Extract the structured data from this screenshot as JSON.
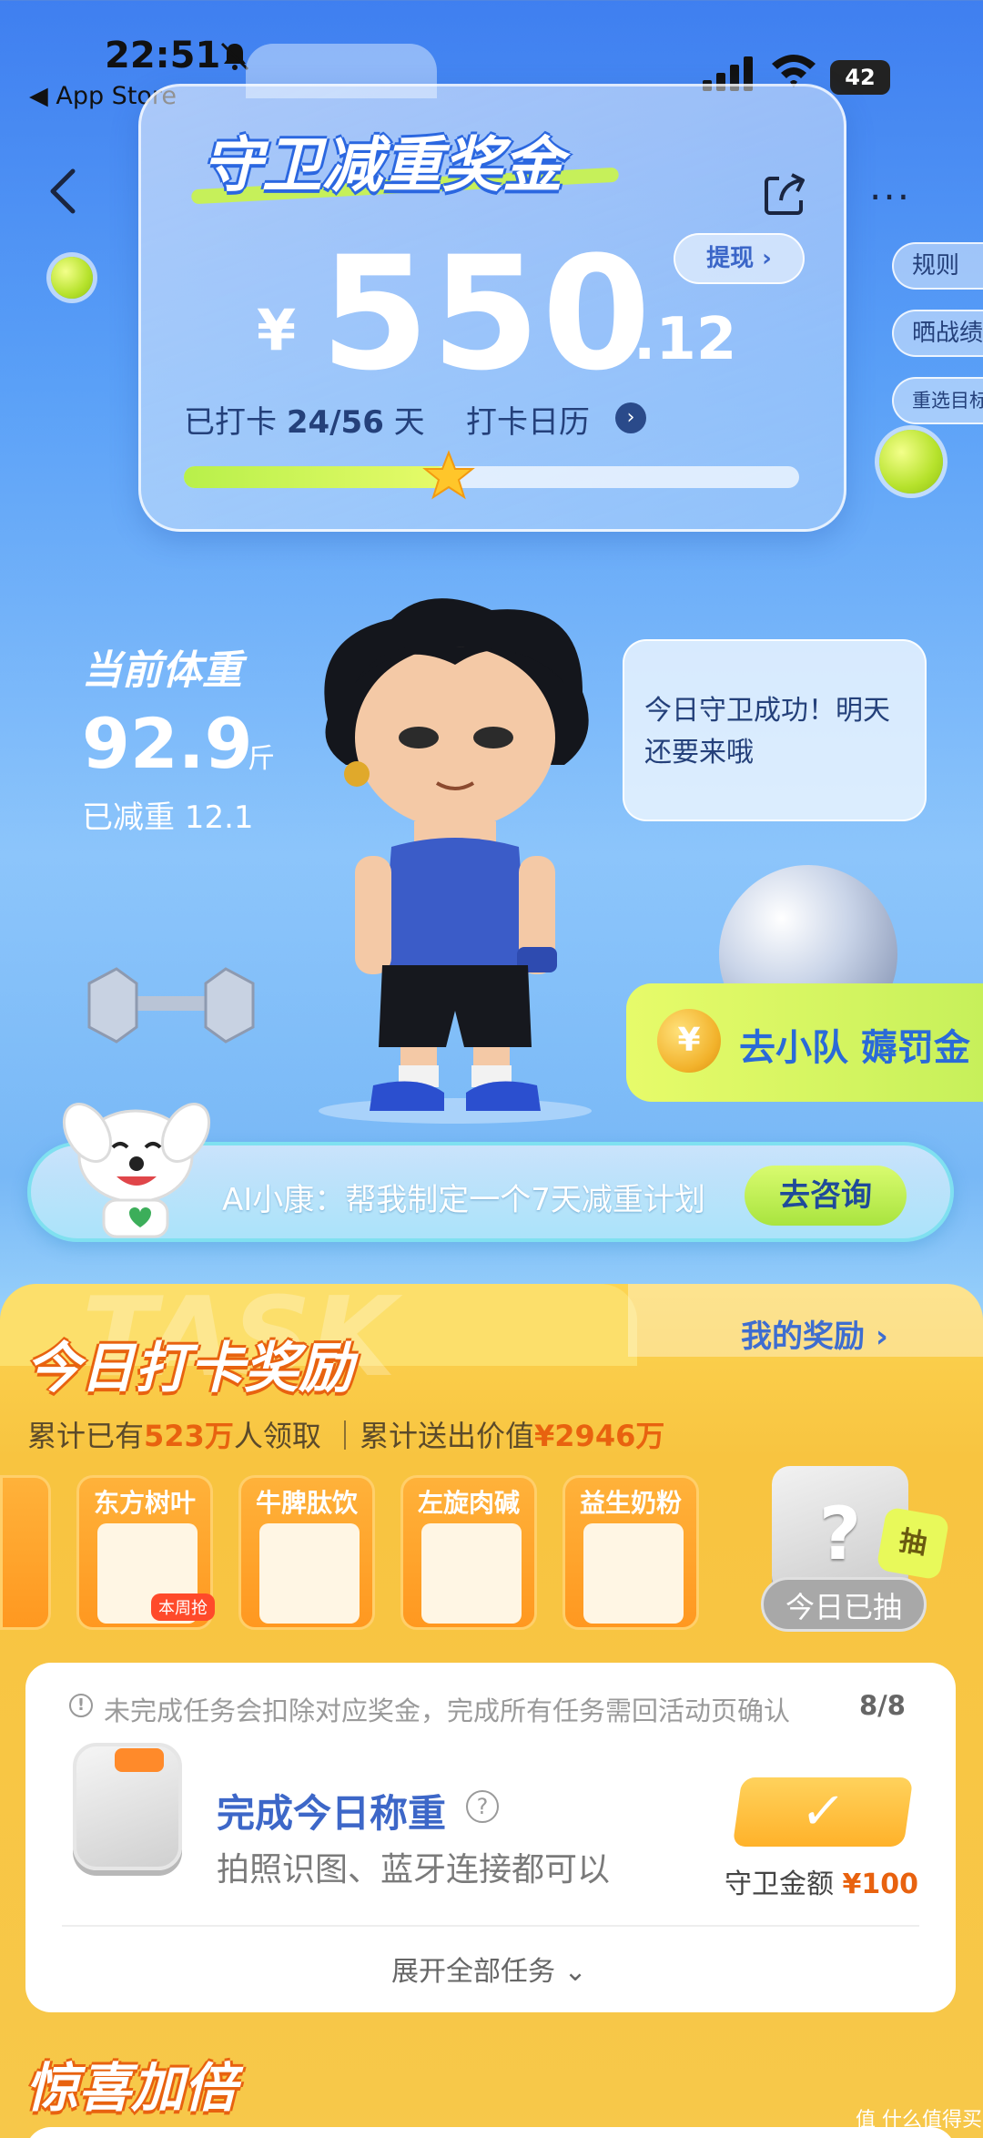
{
  "status_bar": {
    "time": "22:51",
    "back_app": "◀ App Store",
    "battery": "42"
  },
  "header": {
    "title": "守卫减重奖金",
    "withdraw": "提现 ›",
    "currency": "¥",
    "amount_main": "550",
    "amount_decimal": ".12",
    "checkin_prefix": "已打卡 ",
    "checkin_count": "24/56",
    "checkin_suffix": " 天",
    "calendar_link": "打卡日历",
    "progress": 0.43
  },
  "side_menu": {
    "rules": "规则",
    "share_results": "晒战绩",
    "reselect_goal": "重选目标"
  },
  "weight": {
    "label": "当前体重",
    "value": "92.9",
    "unit": "斤",
    "lost": "已减重 12.1"
  },
  "bubble": {
    "text": "今日守卫成功！明天还要来哦"
  },
  "penalty": {
    "coin": "¥",
    "text": "去小队 薅罚金"
  },
  "ai": {
    "text": "AI小康：帮我制定一个7天减重计划",
    "button": "去咨询"
  },
  "rewards": {
    "watermark": "TASK",
    "title": "今日打卡奖励",
    "my_rewards": "我的奖励 ›",
    "stats_a": "累计已有",
    "stats_b": "523万",
    "stats_c": "人领取 ｜累计送出价值",
    "stats_d": "¥2946万",
    "prizes": [
      {
        "name": "东方树叶"
      },
      {
        "name": "牛脾肽饮"
      },
      {
        "name": "左旋肉碱"
      },
      {
        "name": "益生奶粉"
      }
    ],
    "weekly_tag": "本周抢",
    "mystery_mark": "?",
    "draw_badge": "抽",
    "drawn_today": "今日已抽"
  },
  "task_card": {
    "warning_icon": "!",
    "warning": "未完成任务会扣除对应奖金，完成所有任务需回活动页确认",
    "warning_count": "8/8",
    "task_title": "完成今日称重",
    "help_icon": "?",
    "task_sub": "拍照识图、蓝牙连接都可以",
    "check": "✓",
    "reward_label": "守卫金额 ",
    "reward_amount": "¥100",
    "expand": "展开全部任务 ⌄"
  },
  "surprise": {
    "title": "惊喜加倍"
  },
  "watermark": "值 什么值得买",
  "colors": {
    "accent_blue": "#3d67c8",
    "accent_orange": "#e8620f",
    "lime": "#c6f05a",
    "yellow_bg": "#f7c84a"
  }
}
